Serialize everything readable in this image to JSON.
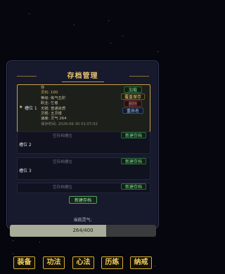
{
  "panel": {
    "title": "存档管理"
  },
  "slots": [
    {
      "label": "槽位 1",
      "star": "★",
      "info": {
        "name": "你",
        "spirit_stones": "灵石: 100",
        "level": "等级: 练气五阶",
        "profession": "职业: 乞者",
        "talent": "天赋: 普通资质",
        "root": "灵根: 五灵根",
        "energy": "速度: 灵气 264",
        "saved_at": "保存时间: 2026-06-30 01:07:02"
      },
      "buttons": {
        "load": "加载",
        "overwrite": "覆盖保存",
        "delete": "删除",
        "rename": "重命名"
      }
    },
    {
      "label": "槽位 2",
      "empty_text": "空存档槽位",
      "new_button": "新建存档"
    },
    {
      "label": "槽位 3",
      "empty_text": "空存档槽位",
      "new_button": "新建存档"
    },
    {
      "empty_text": "空存档槽位",
      "new_button": "新建存档"
    }
  ],
  "footer": {
    "new_save_button": "新建存档"
  },
  "qi": {
    "label": "当前灵气:",
    "current": 264,
    "max": 400,
    "text": "264/400"
  },
  "nav": [
    "装备",
    "功法",
    "心法",
    "历练",
    "纳戒"
  ],
  "colors": {
    "accent_gold": "#d9ab34",
    "green": "#4fa460",
    "background": "#05060e"
  }
}
